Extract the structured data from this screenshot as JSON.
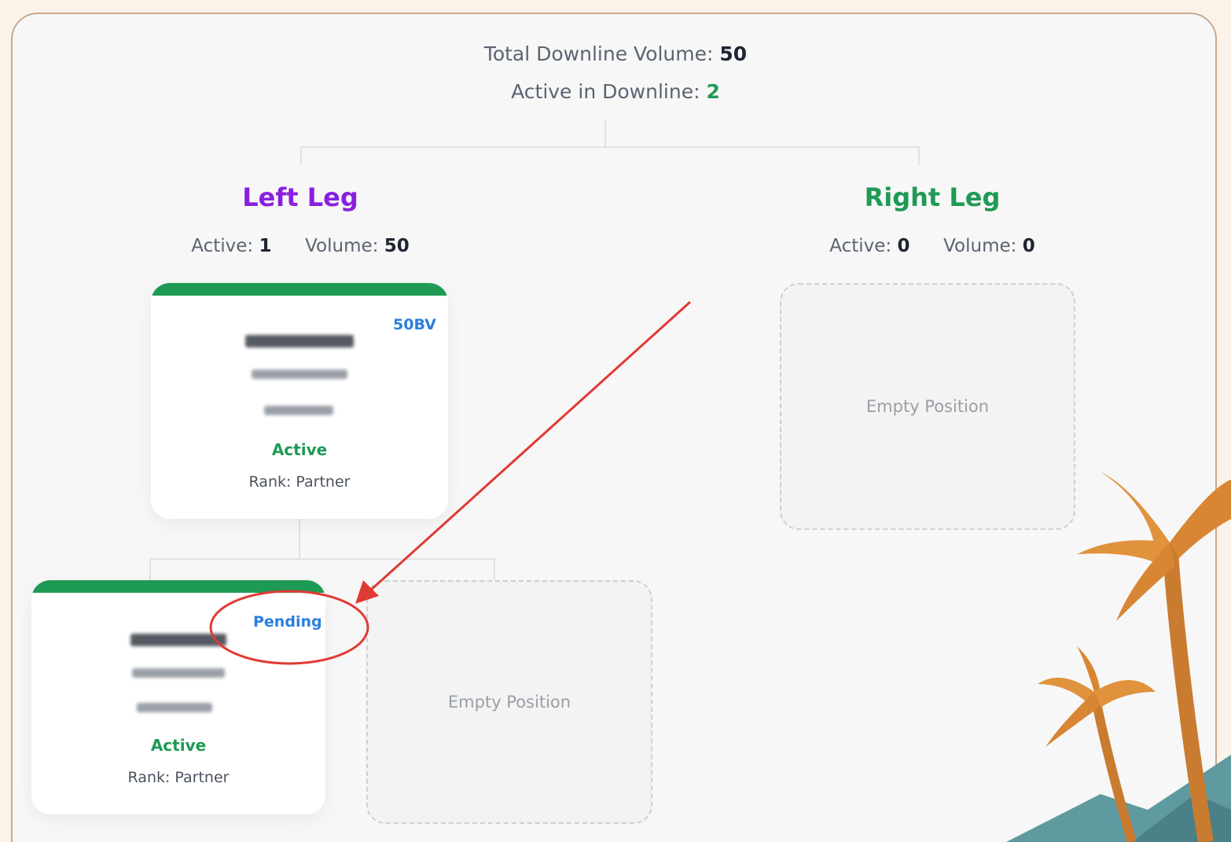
{
  "summary": {
    "total_volume_label": "Total Downline Volume:",
    "total_volume_value": "50",
    "active_label": "Active in Downline:",
    "active_value": "2"
  },
  "left_leg": {
    "title": "Left Leg",
    "title_color": "#8a1fe0",
    "active_label": "Active:",
    "active_value": "1",
    "volume_label": "Volume:",
    "volume_value": "50",
    "member": {
      "badge": "50BV",
      "status": "Active",
      "rank": "Rank: Partner"
    },
    "child_left": {
      "badge": "Pending",
      "status": "Active",
      "rank": "Rank: Partner"
    },
    "child_right": {
      "empty_label": "Empty Position"
    }
  },
  "right_leg": {
    "title": "Right Leg",
    "title_color": "#1f9a55",
    "active_label": "Active:",
    "active_value": "0",
    "volume_label": "Volume:",
    "volume_value": "0",
    "empty_label": "Empty Position"
  },
  "colors": {
    "accent_green": "#1f9a55",
    "badge_blue": "#2a7fde",
    "annotation_red": "#e03a34"
  }
}
